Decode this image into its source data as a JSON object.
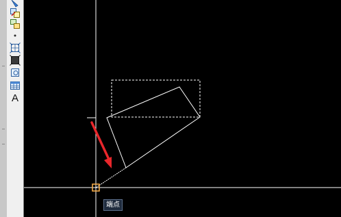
{
  "toolbar": {
    "tools": [
      {
        "icon": "draw-tool-icon"
      },
      {
        "icon": "insert-block-icon"
      },
      {
        "icon": "make-block-icon"
      },
      {
        "icon": "point-icon"
      },
      {
        "icon": "hatch-icon"
      },
      {
        "icon": "gradient-icon"
      },
      {
        "icon": "region-icon"
      },
      {
        "icon": "table-icon"
      },
      {
        "icon": "multiline-text-icon",
        "label": "A"
      }
    ]
  },
  "canvas": {
    "background": "#000000",
    "crosshair_color": "#ffffff",
    "drawn_geometry_color": "#ffffff",
    "preview_color": "#ffffff",
    "snap_marker_color": "#ffb24a",
    "annotation_arrow_color": "#e8262b",
    "snap_tooltip": {
      "text": "端点"
    }
  }
}
